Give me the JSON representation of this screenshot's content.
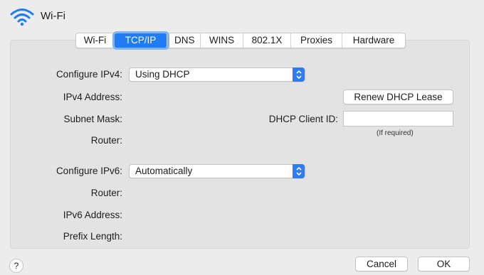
{
  "window": {
    "title": "Wi-Fi",
    "icon": "wifi-icon",
    "accent": "#1f7cf4"
  },
  "tabs": [
    {
      "label": "Wi-Fi",
      "active": false
    },
    {
      "label": "TCP/IP",
      "active": true
    },
    {
      "label": "DNS",
      "active": false
    },
    {
      "label": "WINS",
      "active": false
    },
    {
      "label": "802.1X",
      "active": false
    },
    {
      "label": "Proxies",
      "active": false
    },
    {
      "label": "Hardware",
      "active": false
    }
  ],
  "ipv4": {
    "configure_label": "Configure IPv4:",
    "configure_value": "Using DHCP",
    "address_label": "IPv4 Address:",
    "subnet_label": "Subnet Mask:",
    "router_label": "Router:",
    "renew_button": "Renew DHCP Lease",
    "client_id_label": "DHCP Client ID:",
    "client_id_value": "",
    "client_id_hint": "(If required)"
  },
  "ipv6": {
    "configure_label": "Configure IPv6:",
    "configure_value": "Automatically",
    "router_label": "Router:",
    "address_label": "IPv6 Address:",
    "prefix_label": "Prefix Length:"
  },
  "footer": {
    "help_label": "?",
    "cancel_label": "Cancel",
    "ok_label": "OK"
  }
}
